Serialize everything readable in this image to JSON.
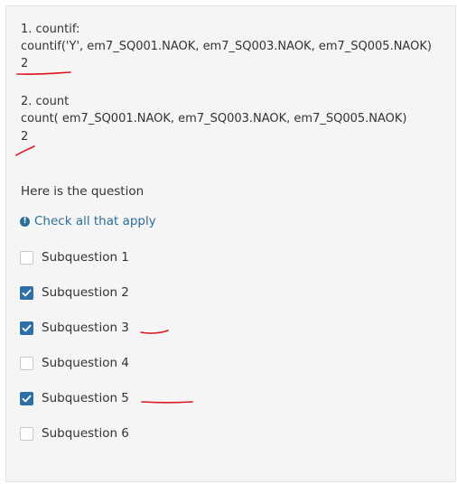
{
  "formula1": {
    "heading": "1. countif:",
    "expression": "countif('Y', em7_SQ001.NAOK, em7_SQ003.NAOK, em7_SQ005.NAOK)",
    "result": "2"
  },
  "formula2": {
    "heading": "2. count",
    "expression": "count( em7_SQ001.NAOK, em7_SQ003.NAOK, em7_SQ005.NAOK)",
    "result": "2"
  },
  "question": {
    "text": "Here is the question",
    "help_icon": "info-circle-icon",
    "help_text": "Check all that apply",
    "accent_color": "#2a6f97"
  },
  "options": [
    {
      "label": "Subquestion 1",
      "checked": false
    },
    {
      "label": "Subquestion 2",
      "checked": true
    },
    {
      "label": "Subquestion 3",
      "checked": true
    },
    {
      "label": "Subquestion 4",
      "checked": false
    },
    {
      "label": "Subquestion 5",
      "checked": true
    },
    {
      "label": "Subquestion 6",
      "checked": false
    }
  ],
  "checkbox_checked_color": "#2f6fa8",
  "annotation_color": "#e0141e"
}
